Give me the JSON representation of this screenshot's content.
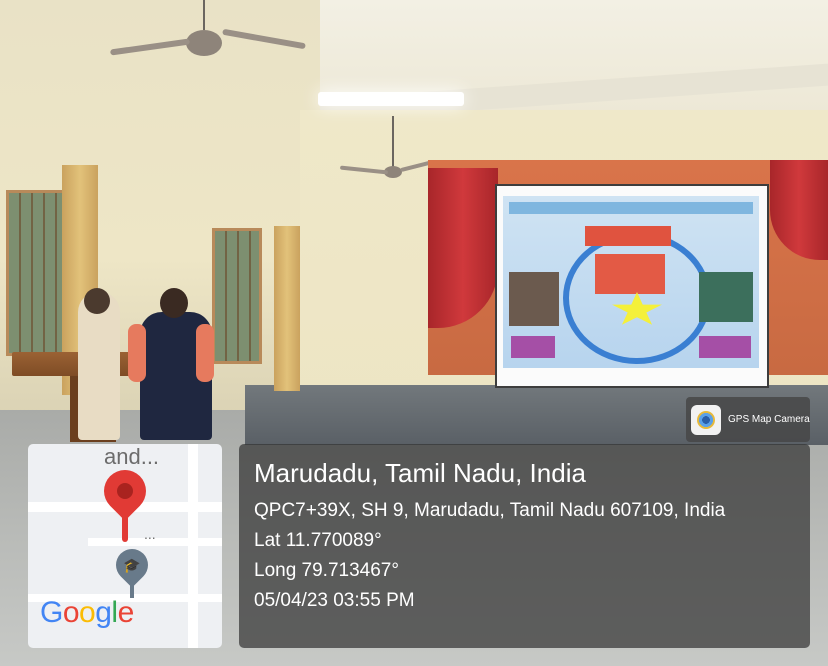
{
  "badge": {
    "label": "GPS Map Camera"
  },
  "location": {
    "title": "Marudadu, Tamil Nadu, India",
    "address": "QPC7+39X, SH 9, Marudadu, Tamil Nadu 607109, India",
    "lat": "Lat 11.770089°",
    "long": "Long 79.713467°",
    "datetime": "05/04/23 03:55 PM"
  },
  "map": {
    "place_label": "and...",
    "poi_dots": "...",
    "logo": {
      "letters": [
        "G",
        "o",
        "o",
        "g",
        "l",
        "e"
      ],
      "colors": [
        "#4285F4",
        "#EA4335",
        "#FBBC05",
        "#4285F4",
        "#34A853",
        "#EA4335"
      ]
    },
    "pin_color": "#E13A35",
    "poi_icon": "school-icon"
  },
  "scene": {
    "description_icons": [
      "ceiling-fan-icon",
      "projector-screen-icon",
      "podium-icon"
    ]
  }
}
